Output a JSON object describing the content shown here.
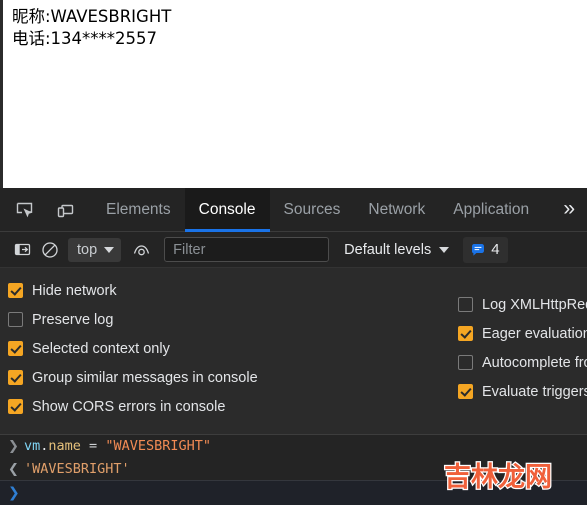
{
  "page": {
    "lines": [
      "昵称:WAVESBRIGHT",
      "电话:134****2557"
    ]
  },
  "devtools": {
    "toolbar_icons": [
      {
        "name": "inspect-element-icon",
        "label": "Inspect element"
      },
      {
        "name": "device-toolbar-icon",
        "label": "Toggle device toolbar"
      }
    ],
    "tabs": [
      {
        "label": "Elements",
        "active": false
      },
      {
        "label": "Console",
        "active": true
      },
      {
        "label": "Sources",
        "active": false
      },
      {
        "label": "Network",
        "active": false
      },
      {
        "label": "Application",
        "active": false
      }
    ],
    "overflow_label": "»",
    "filterbar": {
      "sidebar_toggle": "Show console sidebar",
      "clear_console": "Clear console",
      "context": "top",
      "live_expression": "Create live expression",
      "filter_placeholder": "Filter",
      "filter_value": "",
      "levels_label": "Default levels",
      "message_count": "4"
    },
    "settings": {
      "left_options": [
        {
          "label": "Hide network",
          "checked": true
        },
        {
          "label": "Preserve log",
          "checked": false
        },
        {
          "label": "Selected context only",
          "checked": true
        },
        {
          "label": "Group similar messages in console",
          "checked": true
        },
        {
          "label": "Show CORS errors in console",
          "checked": true
        }
      ],
      "right_options": [
        {
          "label": "Log XMLHttpRequests",
          "checked": false
        },
        {
          "label": "Eager evaluation",
          "checked": true
        },
        {
          "label": "Autocomplete from history",
          "checked": false
        },
        {
          "label": "Evaluate triggers user activation",
          "checked": true
        }
      ]
    },
    "console": {
      "input_chevron": "❯",
      "output_chevron": "❮",
      "input_tokens": {
        "object": "vm",
        "dot": ".",
        "property": "name",
        "operator": " = ",
        "string": "\"WAVESBRIGHT\""
      },
      "result": "'WAVESBRIGHT'",
      "prompt_chevron": "❯"
    }
  },
  "watermark": {
    "text": "吉林龙网"
  }
}
